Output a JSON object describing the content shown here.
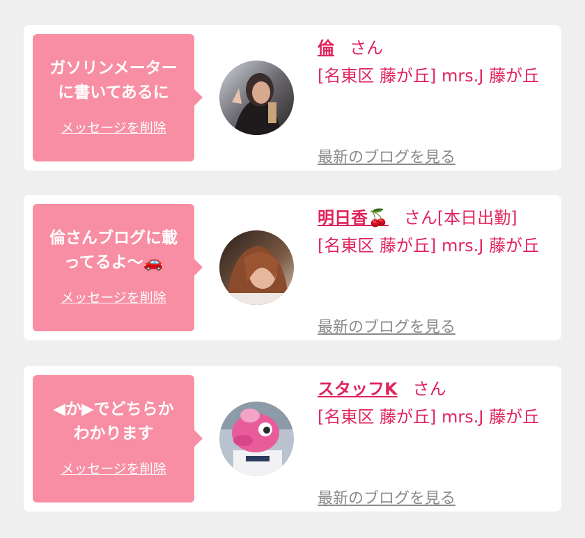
{
  "messages": [
    {
      "bubble_text": "ガソリンメーター\nに書いてあるに",
      "delete_label": "メッセージを削除",
      "name": "倫",
      "san": "さん",
      "status": "",
      "shop": "[名東区 藤が丘] mrs.J 藤が丘",
      "blog_link": "最新のブログを見る"
    },
    {
      "bubble_text": "倫さんブログに載\nってるよ〜🚗",
      "delete_label": "メッセージを削除",
      "name": "明日香🍒",
      "san": "さん",
      "status": "[本日出勤]",
      "shop": "[名東区 藤が丘] mrs.J 藤が丘",
      "blog_link": "最新のブログを見る"
    },
    {
      "bubble_text": "◀か▶でどちらか\nわかります",
      "delete_label": "メッセージを削除",
      "name": "スタッフK",
      "san": "さん",
      "status": "",
      "shop": "[名東区 藤が丘] mrs.J 藤が丘",
      "blog_link": "最新のブログを見る"
    }
  ],
  "colors": {
    "bubble": "#f88ea3",
    "accent": "#e0245e",
    "muted_link": "#8a8a8a",
    "background": "#efefef"
  }
}
